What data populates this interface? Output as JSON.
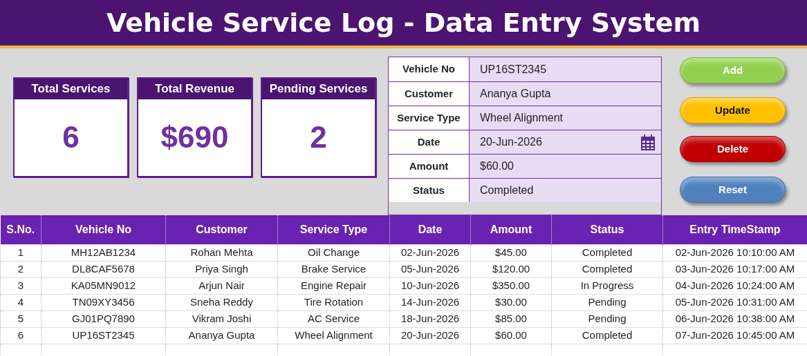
{
  "title": "Vehicle Service Log - Data Entry System",
  "kpis": [
    {
      "label": "Total Services",
      "value": "6"
    },
    {
      "label": "Total Revenue",
      "value": "$690"
    },
    {
      "label": "Pending Services",
      "value": "2"
    }
  ],
  "form": [
    {
      "label": "Vehicle No",
      "value": "UP16ST2345",
      "kind": "text"
    },
    {
      "label": "Customer",
      "value": "Ananya Gupta",
      "kind": "text"
    },
    {
      "label": "Service Type",
      "value": "Wheel Alignment",
      "kind": "text"
    },
    {
      "label": "Date",
      "value": "20-Jun-2026",
      "kind": "date"
    },
    {
      "label": "Amount",
      "value": "$60.00",
      "kind": "text"
    },
    {
      "label": "Status",
      "value": "Completed",
      "kind": "text"
    }
  ],
  "buttons": [
    {
      "label": "Add",
      "color": "#92d050"
    },
    {
      "label": "Update",
      "color": "#ffc000"
    },
    {
      "label": "Delete",
      "color": "#c00000"
    },
    {
      "label": "Reset",
      "color": "#4f81bd"
    }
  ],
  "table": {
    "columns": [
      "S.No.",
      "Vehicle No",
      "Customer",
      "Service Type",
      "Date",
      "Amount",
      "Status",
      "Entry TimeStamp"
    ],
    "rows": [
      [
        "1",
        "MH12AB1234",
        "Rohan Mehta",
        "Oil Change",
        "02-Jun-2026",
        "$45.00",
        "Completed",
        "02-Jun-2026 10:10:00 AM"
      ],
      [
        "2",
        "DL8CAF5678",
        "Priya Singh",
        "Brake Service",
        "05-Jun-2026",
        "$120.00",
        "Completed",
        "03-Jun-2026 10:17:00 AM"
      ],
      [
        "3",
        "KA05MN9012",
        "Arjun Nair",
        "Engine Repair",
        "10-Jun-2026",
        "$350.00",
        "In Progress",
        "04-Jun-2026 10:24:00 AM"
      ],
      [
        "4",
        "TN09XY3456",
        "Sneha Reddy",
        "Tire Rotation",
        "14-Jun-2026",
        "$30.00",
        "Pending",
        "05-Jun-2026 10:31:00 AM"
      ],
      [
        "5",
        "GJ01PQ7890",
        "Vikram Joshi",
        "AC Service",
        "18-Jun-2026",
        "$85.00",
        "Pending",
        "06-Jun-2026 10:38:00 AM"
      ],
      [
        "6",
        "UP16ST2345",
        "Ananya Gupta",
        "Wheel Alignment",
        "20-Jun-2026",
        "$60.00",
        "Completed",
        "07-Jun-2026 10:45:00 AM"
      ]
    ]
  }
}
